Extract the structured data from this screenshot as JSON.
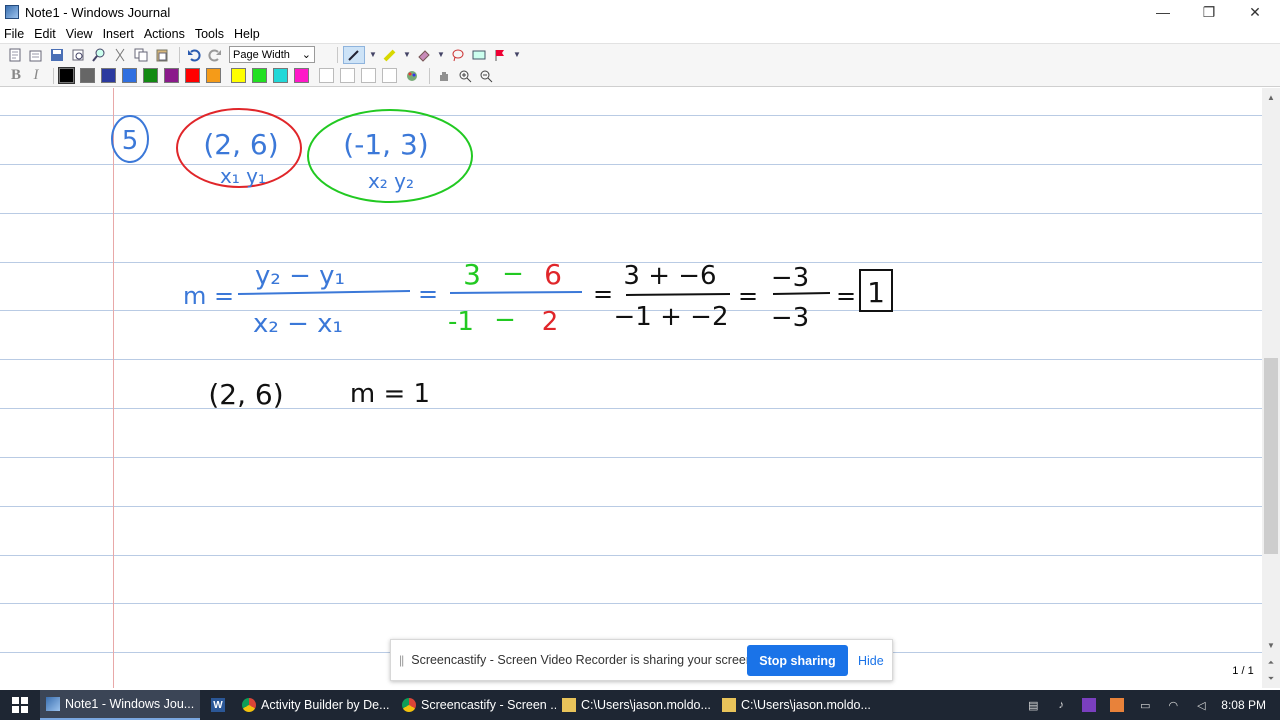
{
  "window": {
    "title": "Note1 - Windows Journal",
    "minimize": "—",
    "maximize": "❐",
    "close": "✕"
  },
  "menu": [
    "File",
    "Edit",
    "View",
    "Insert",
    "Actions",
    "Tools",
    "Help"
  ],
  "toolbar": {
    "zoom_value": "Page Width"
  },
  "colors": {
    "black": "#000000",
    "gray": "#666666",
    "navy": "#2b3a9f",
    "blue": "#2f6fe0",
    "green": "#128a12",
    "purple": "#8b1a8b",
    "red": "#ff0000",
    "orange": "#f59b18",
    "yellow": "#ffff00",
    "lime": "#22e022",
    "cyan": "#22d8d8",
    "magenta": "#ff18c8",
    "ink_blue": "#3b78d8",
    "ink_red": "#e0262a",
    "ink_green": "#22c922",
    "ink_black": "#111111"
  },
  "handwriting": {
    "problem_number": "5",
    "point1": "(2, 6)",
    "point1_labels": "x₁ y₁",
    "point2": "(-1, 3)",
    "point2_labels": "x₂ y₂",
    "formula_lhs": "m =",
    "formula_num": "y₂ − y₁",
    "formula_den": "x₂ − x₁",
    "eq1": "=",
    "sub_num_a": "3",
    "sub_num_op": "−",
    "sub_num_b": "6",
    "sub_den_a": "-1",
    "sub_den_op": "−",
    "sub_den_b": "2",
    "eq2": "=",
    "step_num": "3 + −6",
    "step_den": "−1 + −2",
    "eq3": "=",
    "frac_num": "−3",
    "frac_den": "−3",
    "eq4": "=",
    "answer": "1",
    "point_again": "(2, 6)",
    "slope_again": "m = 1"
  },
  "page_counter": "1 / 1",
  "share_bar": {
    "message": "Screencastify - Screen Video Recorder is sharing your screen.",
    "stop_label": "Stop sharing",
    "hide_label": "Hide"
  },
  "taskbar": {
    "tasks": [
      "Note1 - Windows Jou...",
      "",
      "Activity Builder by De...",
      "Screencastify - Screen ...",
      "C:\\Users\\jason.moldo...",
      "C:\\Users\\jason.moldo..."
    ],
    "clock": "8:08 PM"
  }
}
